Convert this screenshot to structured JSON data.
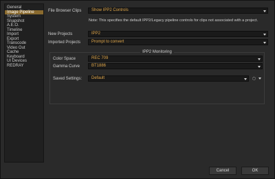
{
  "sidebar": {
    "items": [
      {
        "label": "General",
        "selected": false
      },
      {
        "label": "Image Pipeline",
        "selected": true
      },
      {
        "label": "System",
        "selected": false
      },
      {
        "label": "Snapshot",
        "selected": false
      },
      {
        "label": "A.E.O.",
        "selected": false
      },
      {
        "label": "Timeline",
        "selected": false
      },
      {
        "label": "Import",
        "selected": false
      },
      {
        "label": "Export",
        "selected": false
      },
      {
        "label": "Transcode",
        "selected": false
      },
      {
        "label": "Video Out",
        "selected": false
      },
      {
        "label": "Cache",
        "selected": false
      },
      {
        "label": "Keyboard",
        "selected": false
      },
      {
        "label": "UI Devices",
        "selected": false
      },
      {
        "label": "REDRAY",
        "selected": false
      }
    ]
  },
  "settings": {
    "file_browser_clips": {
      "label": "File Browser Clips",
      "value": "Show IPP2 Controls"
    },
    "note": "Note: This specifies the default IPP2/Legacy pipeline controls for clips not associated with a project.",
    "new_projects": {
      "label": "New Projects",
      "value": "IPP2"
    },
    "imported_projects": {
      "label": "Imported Projects",
      "value": "Prompt to convert"
    }
  },
  "monitoring": {
    "title": "IPP2 Monitoring",
    "color_space": {
      "label": "Color Space",
      "value": "REC 709"
    },
    "gamma_curve": {
      "label": "Gamma Curve",
      "value": "BT1886"
    },
    "saved_settings": {
      "label": "Saved Settings:",
      "value": "Default"
    }
  },
  "footer": {
    "cancel_label": "Cancel",
    "ok_label": "OK"
  },
  "colors": {
    "accent_text": "#e0a74a",
    "selected_bg": "#8a6a2e",
    "panel_bg": "#2a2a2a"
  },
  "icons": {
    "dropdown": "chevron-down-icon",
    "settings": "gear-icon"
  }
}
